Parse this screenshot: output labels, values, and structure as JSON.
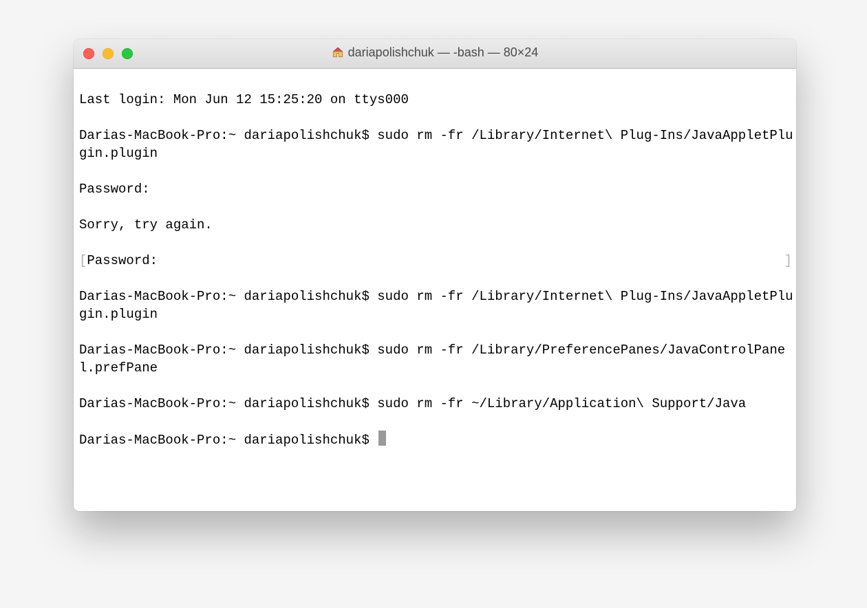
{
  "window": {
    "title": "dariapolishchuk — -bash — 80×24"
  },
  "terminal": {
    "last_login": "Last login: Mon Jun 12 15:25:20 on ttys000",
    "prompt": "Darias-MacBook-Pro:~ dariapolishchuk$ ",
    "cmd1": "sudo rm -fr /Library/Internet\\ Plug-Ins/JavaAppletPlugin.plugin",
    "pwd": "Password:",
    "sorry": "Sorry, try again.",
    "pwd2": "Password:",
    "cmd2": "sudo rm -fr /Library/Internet\\ Plug-Ins/JavaAppletPlugin.plugin",
    "cmd3": "sudo rm -fr /Library/PreferencePanes/JavaControlPanel.prefPane",
    "cmd4": "sudo rm -fr ~/Library/Application\\ Support/Java"
  }
}
